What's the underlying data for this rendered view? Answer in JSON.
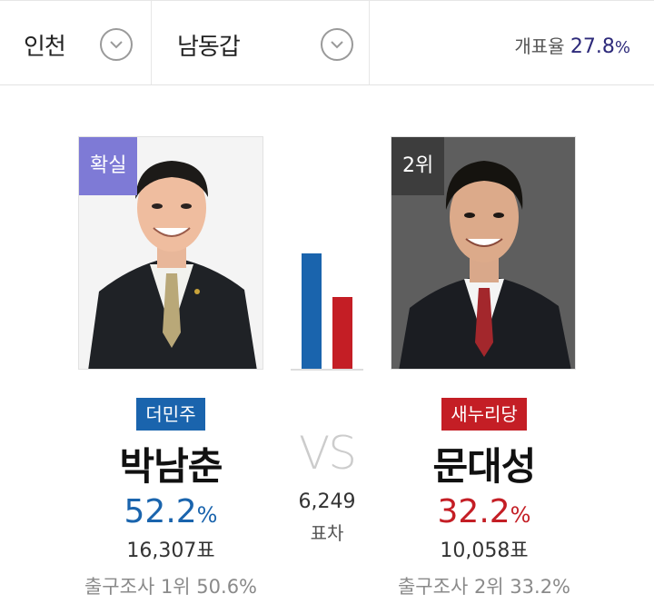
{
  "filters": {
    "region": "인천",
    "district": "남동갑",
    "turnout_label": "개표율",
    "turnout_value": "27.8",
    "turnout_unit": "%"
  },
  "candidates": {
    "left": {
      "status": "확실",
      "party": "더민주",
      "name": "박남춘",
      "pct_value": "52.2",
      "pct_unit": "%",
      "votes": "16,307표",
      "exit_poll": "출구조사 1위 50.6%",
      "vote_share": 52.2,
      "color": "#1a64ad"
    },
    "right": {
      "status": "2위",
      "party": "새누리당",
      "name": "문대성",
      "pct_value": "32.2",
      "pct_unit": "%",
      "votes": "10,058표",
      "exit_poll": "출구조사 2위 33.2%",
      "vote_share": 32.2,
      "color": "#c41e25"
    }
  },
  "comparison": {
    "vs": "VS",
    "margin": "6,249",
    "margin_label": "표차"
  }
}
